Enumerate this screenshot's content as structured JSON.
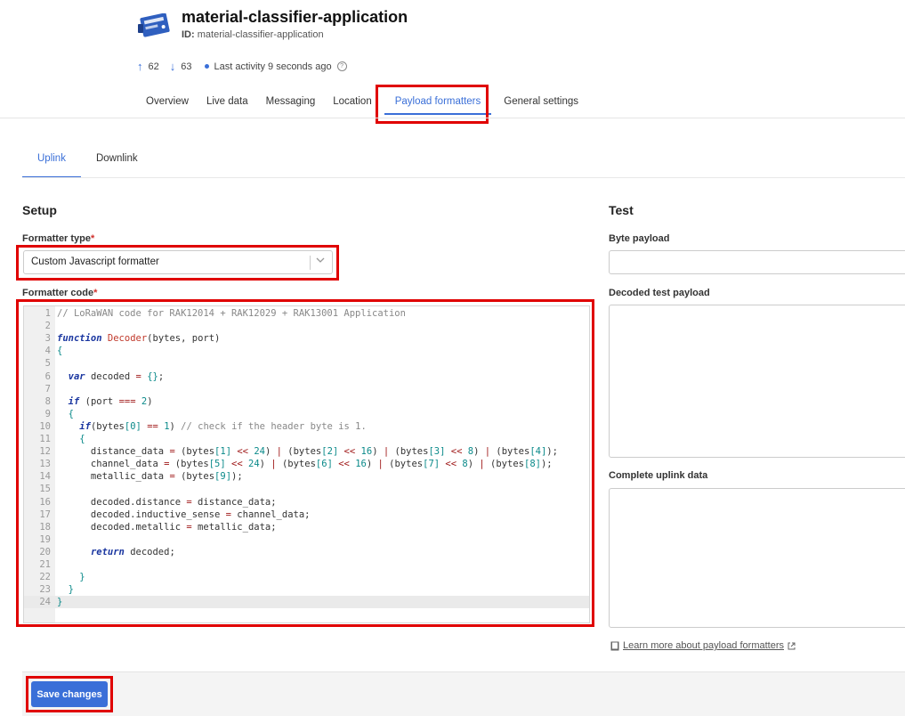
{
  "app": {
    "title": "material-classifier-application",
    "id_prefix": "ID:",
    "id_value": "material-classifier-application",
    "icon": "application-icon"
  },
  "stats": {
    "uplink_count": "62",
    "downlink_count": "63",
    "activity": "Last activity 9 seconds ago"
  },
  "main_tabs": [
    {
      "label": "Overview",
      "active": false
    },
    {
      "label": "Live data",
      "active": false
    },
    {
      "label": "Messaging",
      "active": false
    },
    {
      "label": "Location",
      "active": false
    },
    {
      "label": "Payload formatters",
      "active": true
    },
    {
      "label": "General settings",
      "active": false
    }
  ],
  "sub_tabs": [
    {
      "label": "Uplink",
      "active": true
    },
    {
      "label": "Downlink",
      "active": false
    }
  ],
  "setup": {
    "heading": "Setup",
    "formatter_type_label": "Formatter type",
    "formatter_type_value": "Custom Javascript formatter",
    "formatter_code_label": "Formatter code",
    "required_mark": "*"
  },
  "code_lines": [
    "// LoRaWAN code for RAK12014 + RAK12029 + RAK13001 Application",
    "",
    "function Decoder(bytes, port)",
    "{",
    "",
    "  var decoded = {};",
    "",
    "  if (port === 2)",
    "  {",
    "    if(bytes[0] == 1) // check if the header byte is 1.",
    "    {",
    "      distance_data = (bytes[1] << 24) | (bytes[2] << 16) | (bytes[3] << 8) | (bytes[4]);",
    "      channel_data = (bytes[5] << 24) | (bytes[6] << 16) | (bytes[7] << 8) | (bytes[8]);",
    "      metallic_data = (bytes[9]);",
    "",
    "      decoded.distance = distance_data;",
    "      decoded.inductive_sense = channel_data;",
    "      decoded.metallic = metallic_data;",
    "",
    "      return decoded;",
    "",
    "    }",
    "  }",
    "}"
  ],
  "test": {
    "heading": "Test",
    "byte_payload_label": "Byte payload",
    "decoded_label": "Decoded test payload",
    "uplink_label": "Complete uplink data",
    "learn_more": "Learn more about payload formatters"
  },
  "footer": {
    "save_label": "Save changes"
  },
  "colors": {
    "accent": "#3a6fd8",
    "highlight": "#e00000"
  }
}
